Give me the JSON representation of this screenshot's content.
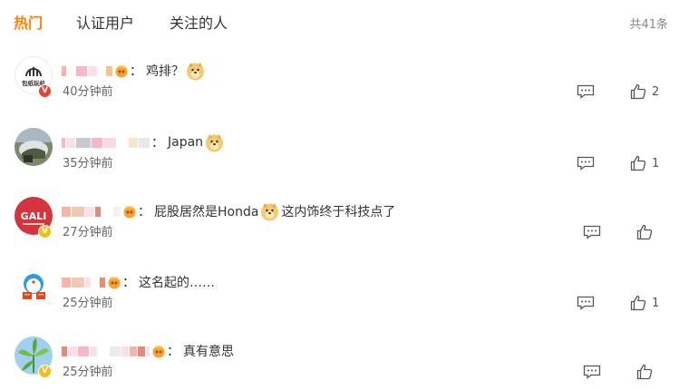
{
  "tabs": {
    "hot": "热门",
    "verified": "认证用户",
    "following": "关注的人"
  },
  "total": "共41条",
  "colors": {
    "accent": "#ff8200",
    "badge_red": "#e0442c",
    "badge_gold": "#f6bd16"
  },
  "comments": [
    {
      "text": "鸡排？",
      "time": "40分钟前",
      "likes": "2",
      "badge": "red"
    },
    {
      "text": "Japan",
      "time": "35分钟前",
      "likes": "1",
      "badge": "none"
    },
    {
      "text_before": "屁股居然是Honda",
      "text_after": "这内饰终于科技点了",
      "time": "27分钟前",
      "likes": "",
      "badge": "gold"
    },
    {
      "text": "这名起的……",
      "time": "25分钟前",
      "likes": "1",
      "badge": "none"
    },
    {
      "text": "真有意思",
      "time": "25分钟前",
      "likes": "",
      "badge": "gold"
    }
  ],
  "logo_text": {
    "avatar1": "包纸玩机",
    "avatar3": "GALI"
  },
  "icons": {
    "reply": "comment-icon",
    "like": "thumbs-up-icon",
    "emoji": "doge-emoji-icon",
    "crown": "fan-crown-icon"
  }
}
